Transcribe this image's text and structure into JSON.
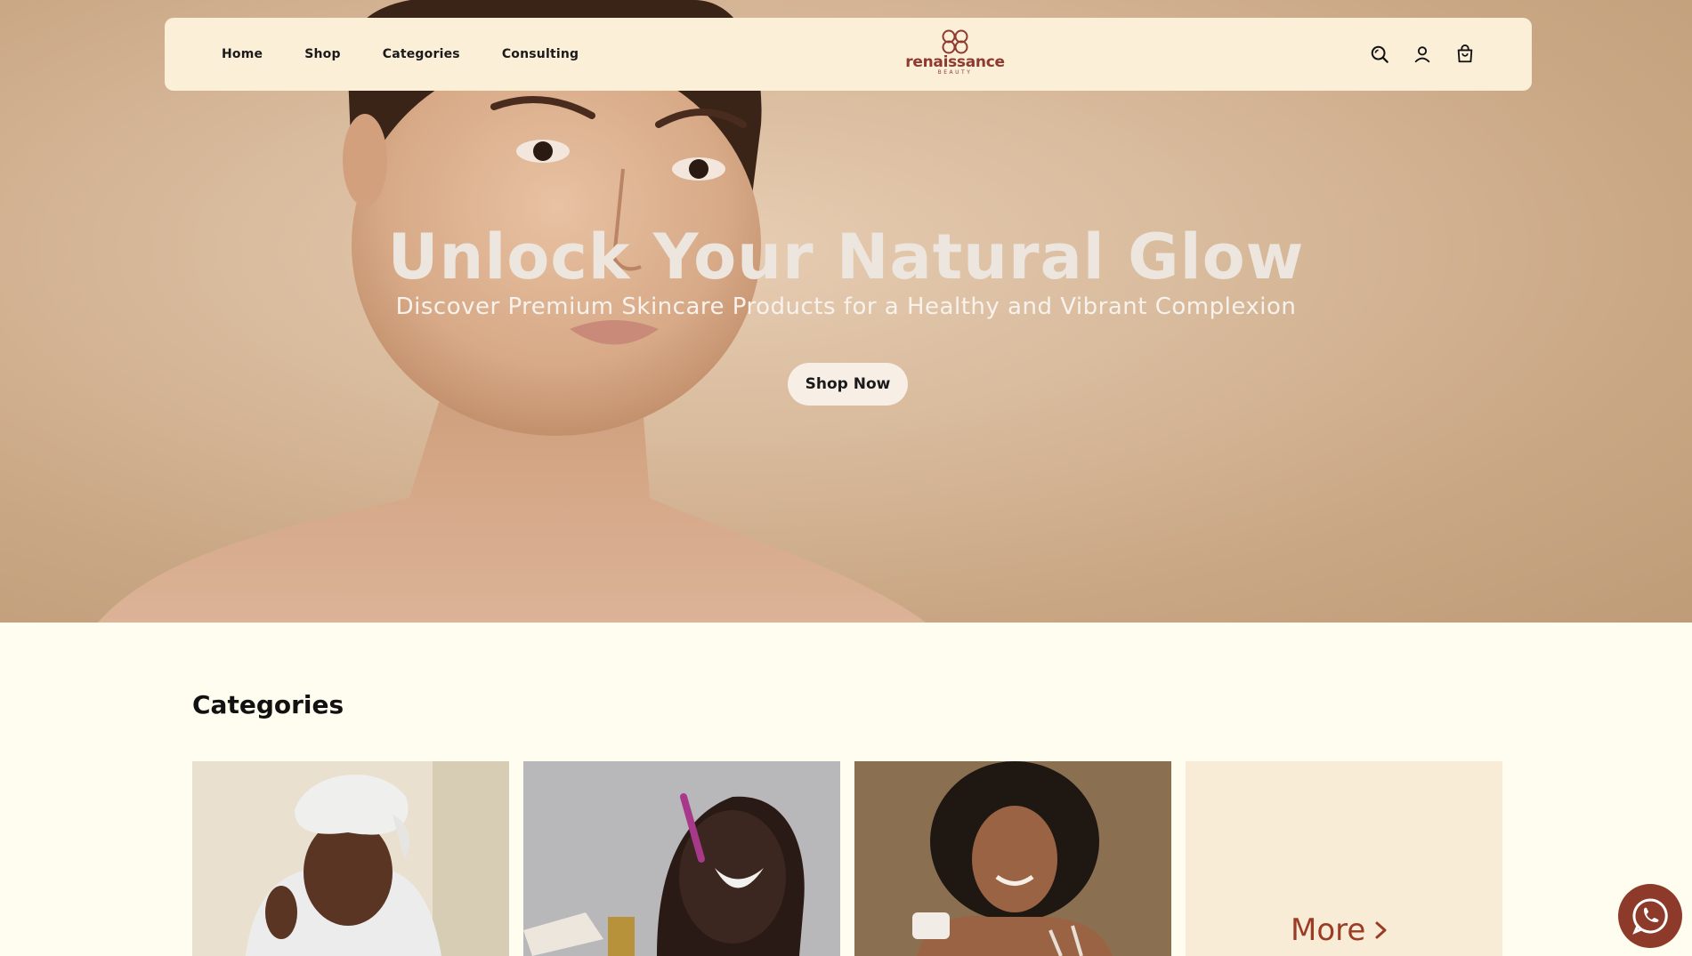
{
  "nav": {
    "links": [
      {
        "label": "Home"
      },
      {
        "label": "Shop"
      },
      {
        "label": "Categories"
      },
      {
        "label": "Consulting"
      }
    ],
    "logo": {
      "name": "renaissance",
      "sub": "BEAUTY"
    },
    "icons": [
      "search-icon",
      "user-icon",
      "cart-icon"
    ]
  },
  "hero": {
    "title": "Unlock Your Natural Glow",
    "subtitle": "Discover Premium Skincare Products for a Healthy and Vibrant Complexion",
    "cta": "Shop Now"
  },
  "categories": {
    "heading": "Categories",
    "more_label": "More"
  },
  "colors": {
    "accent": "#8e3a2e",
    "nav_bg": "#fbefd8",
    "page_bg": "#fffdf0",
    "more_card_bg": "#f9ecd6"
  }
}
